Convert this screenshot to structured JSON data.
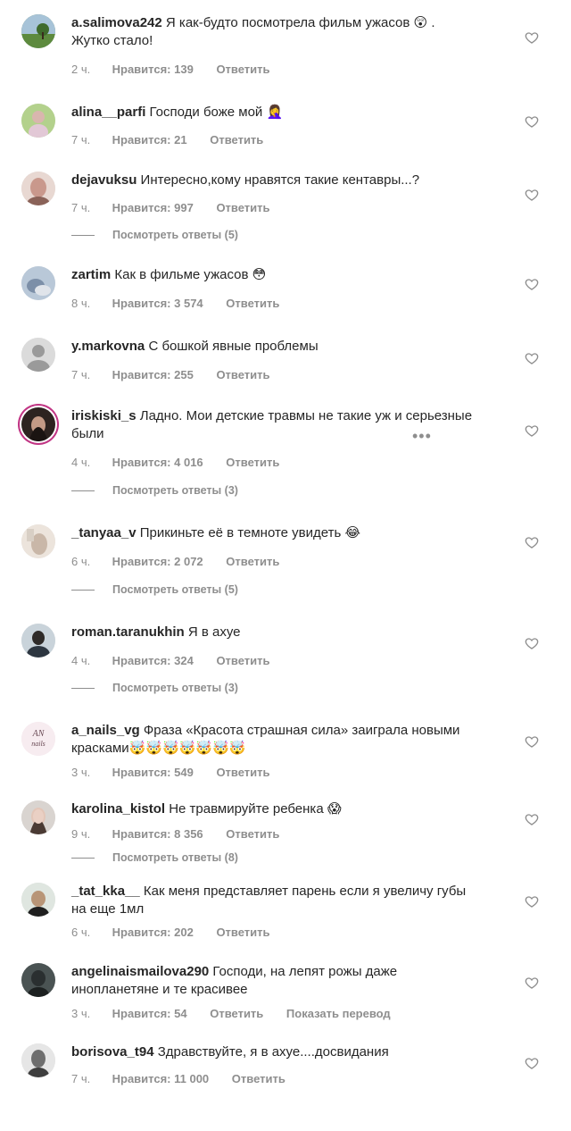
{
  "labels": {
    "likes_prefix": "Нравится: ",
    "reply": "Ответить",
    "translate": "Показать перевод"
  },
  "colors": {
    "text": "#262626",
    "secondary": "#8e8e8e"
  },
  "comments": [
    {
      "user": "a.salimova242",
      "text": "Я как-будто посмотрела фильм ужасов 😲 . Жутко стало!",
      "time": "2 ч.",
      "likes": "Нравится: 139",
      "reply": "Ответить",
      "avatar_color": "#6f8f56",
      "avatar_icon": "landscape-avatar"
    },
    {
      "user": "alina__parfi",
      "text": "Господи боже мой 🤦‍♀️",
      "time": "7 ч.",
      "likes": "Нравится: 21",
      "reply": "Ответить",
      "avatar_color": "#9b7a74",
      "avatar_icon": "photo-avatar"
    },
    {
      "user": "dejavuksu",
      "text": "Интересно,кому нравятся такие кентавры...?",
      "time": "7 ч.",
      "likes": "Нравится: 997",
      "reply": "Ответить",
      "view_replies": "Посмотреть ответы (5)",
      "avatar_color": "#b8908a",
      "avatar_icon": "photo-avatar"
    },
    {
      "user": "zartim",
      "text": "Как в фильме ужасов 😳",
      "time": "8 ч.",
      "likes": "Нравится: 3 574",
      "reply": "Ответить",
      "avatar_color": "#7b8ea6",
      "avatar_icon": "photo-avatar"
    },
    {
      "user": "y.markovna",
      "text": "С бошкой явные проблемы",
      "time": "7 ч.",
      "likes": "Нравится: 255",
      "reply": "Ответить",
      "avatar_color": "#d8d8d8",
      "avatar_icon": "default-user-avatar"
    },
    {
      "user": "iriskiski_s",
      "text": "Ладно. Мои детские травмы не такие уж и серьезные были",
      "time": "4 ч.",
      "likes": "Нравится: 4 016",
      "reply": "Ответить",
      "view_replies": "Посмотреть ответы (3)",
      "avatar_color": "#5a4a44",
      "avatar_icon": "story-ring-avatar"
    },
    {
      "user": "_tanyaa_v",
      "text": "Прикиньте её в темноте увидеть 😂",
      "time": "6 ч.",
      "likes": "Нравится: 2 072",
      "reply": "Ответить",
      "view_replies": "Посмотреть ответы (5)",
      "avatar_color": "#c9b7a8",
      "avatar_icon": "photo-avatar"
    },
    {
      "user": "roman.taranukhin",
      "text": "Я в ахуе",
      "time": "4 ч.",
      "likes": "Нравится: 324",
      "reply": "Ответить",
      "view_replies": "Посмотреть ответы (3)",
      "avatar_color": "#3f4a55",
      "avatar_icon": "photo-avatar"
    },
    {
      "user": "a_nails_vg",
      "text": "Фраза «Красота страшная сила» заиграла новыми красками🤯🤯🤯🤯🤯🤯🤯",
      "time": "3 ч.",
      "likes": "Нравится: 549",
      "reply": "Ответить",
      "avatar_color": "#f4e4ea",
      "avatar_icon": "logo-avatar",
      "avatar_text": "AN nails"
    },
    {
      "user": "karolina_kistol",
      "text": "Не травмируйте ребенка 😱",
      "time": "9 ч.",
      "likes": "Нравится: 8 356",
      "reply": "Ответить",
      "view_replies": "Посмотреть ответы (8)",
      "avatar_color": "#9a8e8a",
      "avatar_icon": "photo-avatar"
    },
    {
      "user": "_tat_kka__",
      "text": "Как меня представляет парень если я увеличу губы на еще 1мл",
      "time": "6 ч.",
      "likes": "Нравится: 202",
      "reply": "Ответить",
      "avatar_color": "#a48d73",
      "avatar_icon": "photo-avatar"
    },
    {
      "user": "angelinaismailova290",
      "text": "Господи, на лепят рожы даже инопланетяне и те красивее",
      "time": "3 ч.",
      "likes": "Нравится: 54",
      "reply": "Ответить",
      "translate": "Показать перевод",
      "avatar_color": "#3e4444",
      "avatar_icon": "photo-avatar"
    },
    {
      "user": "borisova_t94",
      "text": "Здравствуйте, я в ахуе....досвидания",
      "time": "7 ч.",
      "likes": "Нравится: 11 000",
      "reply": "Ответить",
      "avatar_color": "#6e6e6e",
      "avatar_icon": "photo-avatar"
    }
  ]
}
